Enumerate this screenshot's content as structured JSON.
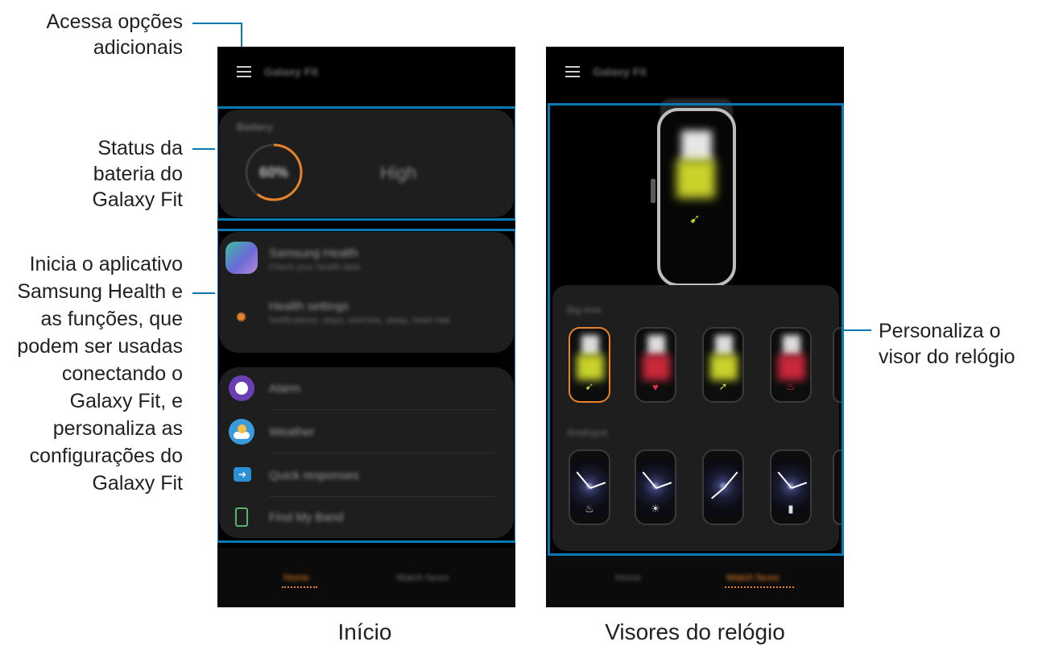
{
  "captions": {
    "menu": [
      "Acessa opções",
      "adicionais"
    ],
    "battery": [
      "Status da",
      "bateria do",
      "Galaxy Fit"
    ],
    "apps": [
      "Inicia o aplicativo",
      "Samsung Health e",
      "as funções, que",
      "podem ser usadas",
      "conectando o",
      "Galaxy Fit, e",
      "personaliza as",
      "configurações do",
      "Galaxy Fit"
    ],
    "watch": [
      "Personaliza o",
      "visor do relógio"
    ],
    "home_screen": "Início",
    "watch_screen": "Visores do relógio"
  },
  "left_phone": {
    "title": "Galaxy Fit",
    "battery_label": "Battery",
    "battery_percent": "60%",
    "battery_level": 0.6,
    "battery_status": "High",
    "samsung_health": "Samsung Health",
    "samsung_health_sub": "Check your health data",
    "health_settings": "Health settings",
    "health_settings_sub": "Notifications, steps, exercise, sleep, heart rate",
    "menu": [
      "Alarm",
      "Weather",
      "Quick responses",
      "Find My Band"
    ],
    "tabs": [
      "Home",
      "Watch faces"
    ],
    "active_tab": "Home"
  },
  "right_phone": {
    "title": "Galaxy Fit",
    "section_big_time": "Big time",
    "section_analogue": "Analogue",
    "tabs": [
      "Home",
      "Watch faces"
    ],
    "active_tab": "Watch faces"
  },
  "colors": {
    "accent": "#e8822a",
    "annotation": "#0a78b4",
    "lime": "#c8d22a",
    "red": "#c8283a"
  }
}
